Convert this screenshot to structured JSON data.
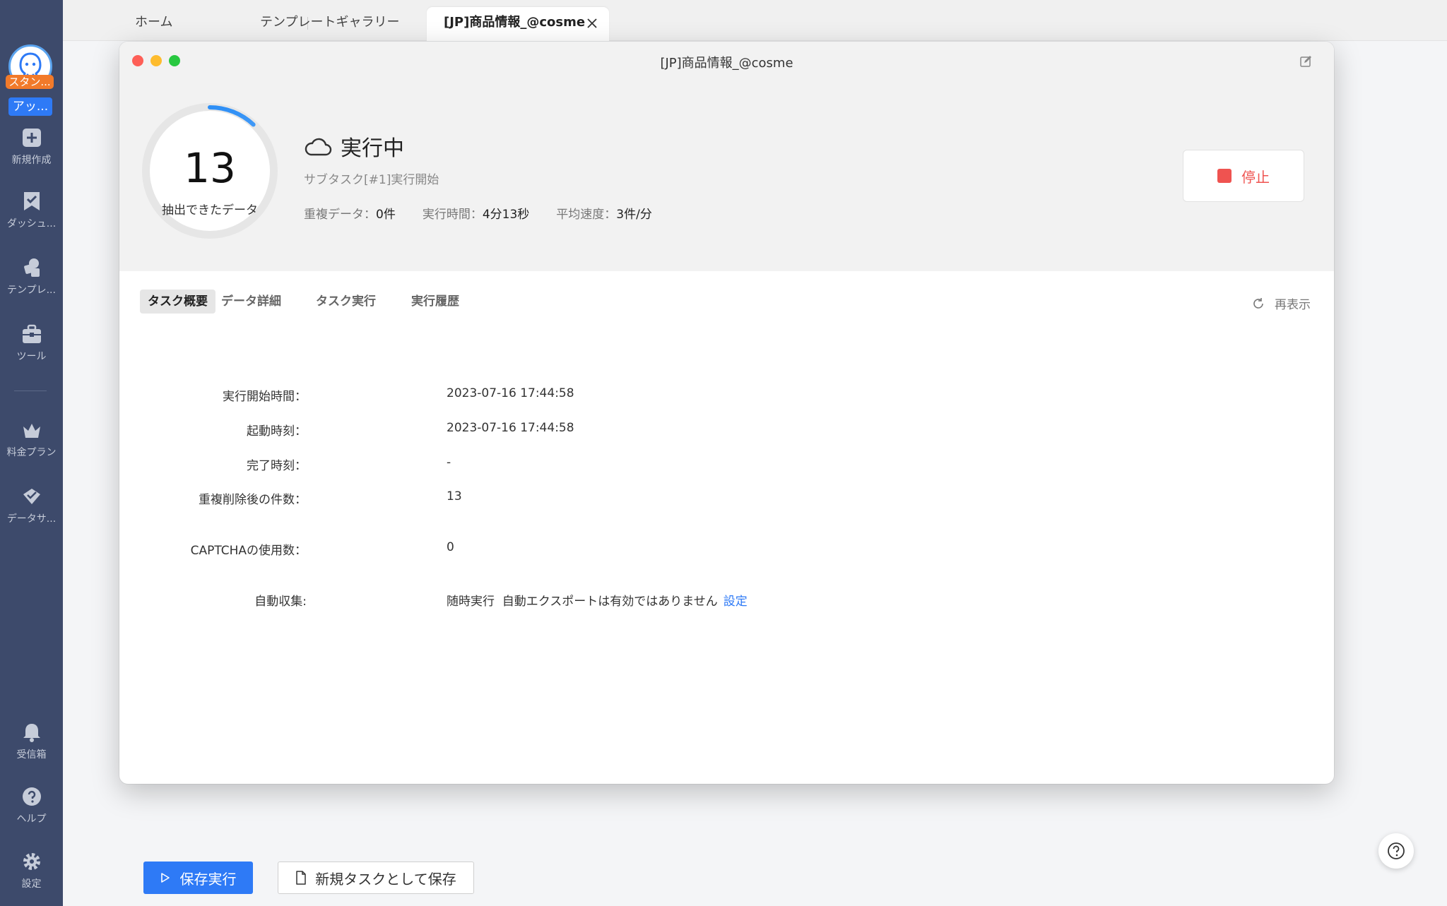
{
  "sidebar": {
    "badge_orange": "スタン...",
    "badge_blue": "アッ...",
    "items": [
      {
        "label": "新規作成",
        "icon": "plus-square-icon"
      },
      {
        "label": "ダッシュ...",
        "icon": "bookmark-check-icon"
      },
      {
        "label": "テンプレ...",
        "icon": "template-icon"
      },
      {
        "label": "ツール",
        "icon": "toolbox-icon"
      },
      {
        "label": "料金プラン",
        "icon": "crown-icon"
      },
      {
        "label": "データサ...",
        "icon": "data-service-icon"
      },
      {
        "label": "受信箱",
        "icon": "bell-icon"
      },
      {
        "label": "ヘルプ",
        "icon": "help-icon"
      },
      {
        "label": "設定",
        "icon": "gear-icon"
      }
    ]
  },
  "tabs": {
    "home": "ホーム",
    "gallery": "テンプレートギャラリー",
    "active": "[JP]商品情報_@cosme"
  },
  "modal": {
    "title": "[JP]商品情報_@cosme",
    "extracted_count": "13",
    "extracted_label": "抽出できたデータ",
    "progress_fraction": 0.12,
    "status": "実行中",
    "sub_status": "サブタスク[#1]実行開始",
    "stats": {
      "dup_label": "重複データ：",
      "dup_value": "0件",
      "time_label": "実行時間：",
      "time_value": "4分13秒",
      "speed_label": "平均速度：",
      "speed_value": "3件/分"
    },
    "stop_label": "停止",
    "subtabs": [
      "タスク概要",
      "データ詳細",
      "タスク実行",
      "実行履歴"
    ],
    "refresh_label": "再表示",
    "info": {
      "start_time_label": "実行開始時間：",
      "start_time_value": "2023-07-16 17:44:58",
      "launch_time_label": "起動時刻：",
      "launch_time_value": "2023-07-16 17:44:58",
      "finish_time_label": "完了時刻：",
      "finish_time_value": "-",
      "dedup_count_label": "重複削除後の件数：",
      "dedup_count_value": "13",
      "captcha_label": "CAPTCHAの使用数：",
      "captcha_value": "0",
      "auto_label": "自動収集:",
      "auto_value": "随時実行  自動エクスポートは有効ではありません",
      "auto_link": "設定"
    }
  },
  "bottom": {
    "save_run": "保存実行",
    "save_new": "新規タスクとして保存"
  },
  "colors": {
    "sidebar_bg": "#3d4a6b",
    "accent_blue": "#2e7af6",
    "stop_red": "#ef5350",
    "badge_orange": "#f27a2a"
  }
}
